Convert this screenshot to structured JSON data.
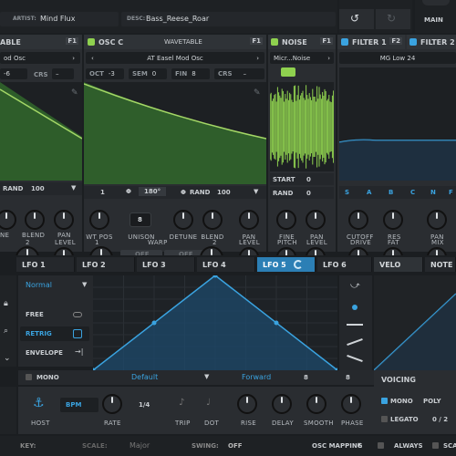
{
  "header": {
    "artist_label": "ARTIST:",
    "artist_value": "Mind Flux",
    "desc_label": "DESC:",
    "desc_value": "Bass_Reese_Roar",
    "main_label": "MAIN"
  },
  "osc_b_partial": {
    "title": "ABLE",
    "fx": "F1",
    "preset": "od Osc",
    "row1_val": "-6",
    "row1_lbl": "CRS",
    "rand_lbl": "RAND",
    "rand_val": "100",
    "knob_labels": [
      "NE",
      "BLEND",
      "PAN"
    ],
    "knob_labels2": [
      "2",
      "LEVEL"
    ]
  },
  "osc_c": {
    "title": "OSC C",
    "type": "WAVETABLE",
    "fx": "F1",
    "preset": "AT Easel Mod Osc",
    "oct_lbl": "OCT",
    "oct_val": "-3",
    "sem_lbl": "SEM",
    "sem_val": "0",
    "fin_lbl": "FIN",
    "fin_val": "8",
    "crs_lbl": "CRS",
    "voices": "1",
    "phase": "180°",
    "rand_lbl": "RAND",
    "rand_val": "100",
    "knob_labels": [
      "WT POS",
      "UNISON",
      "DETUNE",
      "BLEND",
      "PAN"
    ],
    "unison_val": "8",
    "warp_a": "OFF",
    "warp_b": "OFF",
    "warp_lbl": "WARP",
    "bottom_labels": [
      "1",
      "2",
      "LEVEL"
    ]
  },
  "noise": {
    "title": "NOISE",
    "fx": "F1",
    "preset": "Micr...Noise",
    "start_lbl": "START",
    "start_val": "0",
    "rand_lbl": "RAND",
    "rand_val": "0",
    "knob_labels": [
      "FINE",
      "PAN"
    ],
    "knob_labels2": [
      "PITCH",
      "LEVEL"
    ]
  },
  "filter1": {
    "title": "FILTER 1",
    "fx": "F2",
    "preset": "MG Low 24",
    "keys": [
      "S",
      "A",
      "B",
      "C",
      "N",
      "F"
    ],
    "knob_labels": [
      "CUTOFF",
      "RES",
      "PAN"
    ],
    "knob_labels2": [
      "DRIVE",
      "FAT",
      "MIX"
    ]
  },
  "filter2": {
    "title": "FILTER 2"
  },
  "lfo_tabs": [
    "LFO 1",
    "LFO 2",
    "LFO 3",
    "LFO 4",
    "LFO 5",
    "LFO 6"
  ],
  "right_tabs": [
    "VELO",
    "NOTE"
  ],
  "lfo": {
    "mode": "Normal",
    "trigger_options": [
      "FREE",
      "RETRIG",
      "ENVELOPE"
    ],
    "mono_lbl": "MONO",
    "smooth_preset": "Default",
    "direction": "Forward",
    "grid_x": "8",
    "grid_y": "8",
    "host_lbl": "HOST",
    "bpm_lbl": "BPM",
    "rate_lbl": "RATE",
    "rate_val": "1/4",
    "trip_lbl": "TRIP",
    "dot_lbl": "DOT",
    "knob_labels": [
      "RISE",
      "DELAY",
      "SMOOTH",
      "PHASE"
    ]
  },
  "voicing": {
    "title": "VOICING",
    "mono_lbl": "MONO",
    "poly_lbl": "POLY",
    "legato_lbl": "LEGATO",
    "count": "0 / 2"
  },
  "status": {
    "key_lbl": "KEY:",
    "scale_lbl": "SCALE:",
    "scale_val": "Major",
    "swing_lbl": "SWING:",
    "swing_val": "OFF",
    "osc_mapping": "OSC MAPPING",
    "always_lbl": "ALWAYS",
    "scale2_lbl": "SCA"
  },
  "colors": {
    "accent_blue": "#2f9bd8",
    "osc_green": "#8fd14f",
    "filter_blue": "#3aa3e0"
  }
}
